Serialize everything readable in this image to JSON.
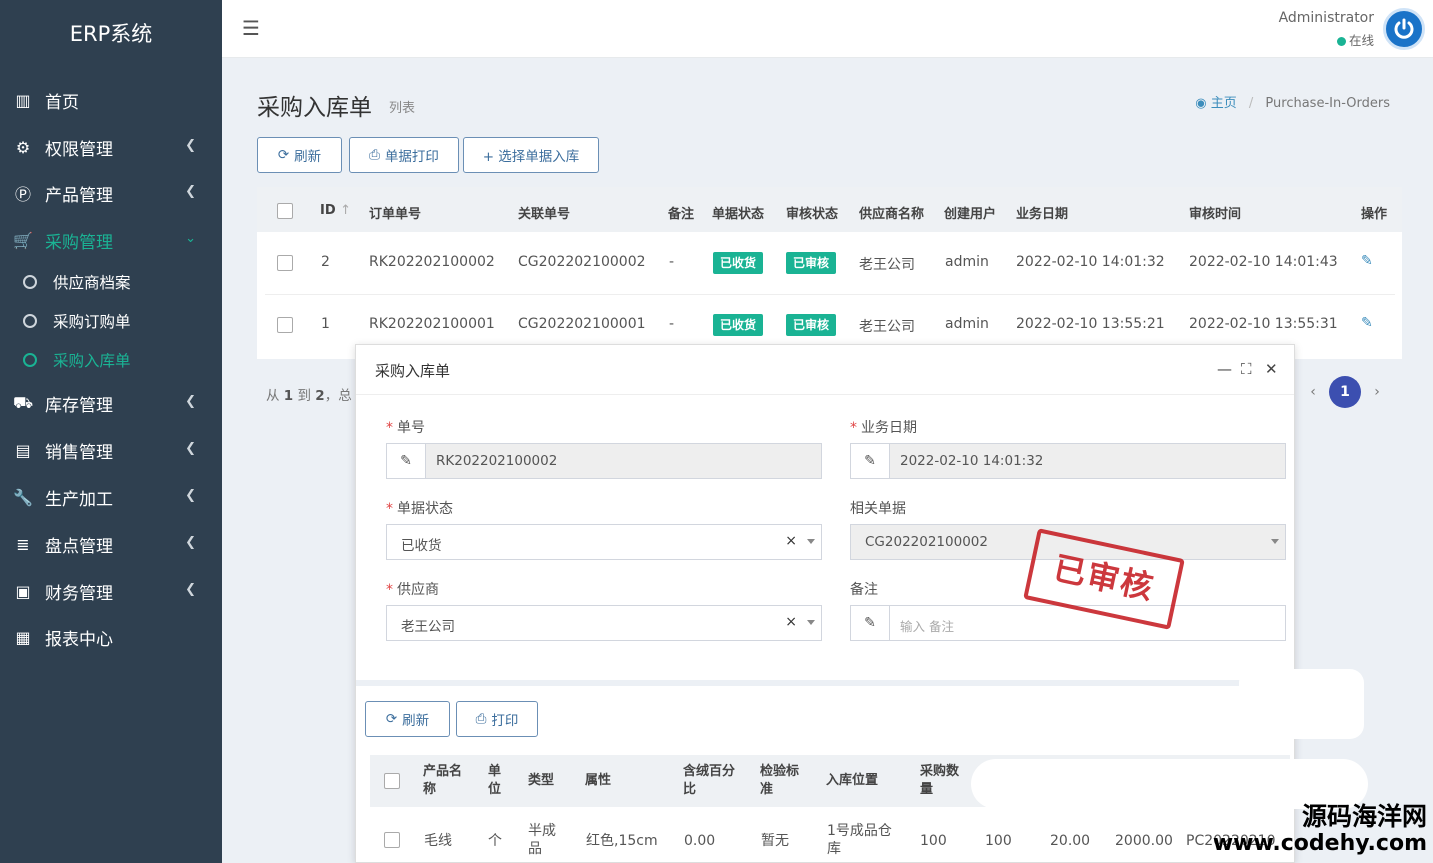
{
  "app": {
    "brand": "ERP系统"
  },
  "sidebar": {
    "items": [
      {
        "label": "首页",
        "icon": "bar-chart-icon"
      },
      {
        "label": "权限管理",
        "icon": "gear-icon"
      },
      {
        "label": "产品管理",
        "icon": "product-p-icon"
      },
      {
        "label": "采购管理",
        "icon": "cart-icon"
      },
      {
        "label": "库存管理",
        "icon": "truck-icon"
      },
      {
        "label": "销售管理",
        "icon": "calendar-icon"
      },
      {
        "label": "生产加工",
        "icon": "wrench-icon"
      },
      {
        "label": "盘点管理",
        "icon": "database-icon"
      },
      {
        "label": "财务管理",
        "icon": "money-icon"
      },
      {
        "label": "报表中心",
        "icon": "calendar-grid-icon"
      }
    ],
    "submenu": [
      "供应商档案",
      "采购订购单",
      "采购入库单"
    ]
  },
  "header": {
    "user_name": "Administrator",
    "user_status": "在线"
  },
  "page": {
    "title": "采购入库单",
    "subtitle": "列表",
    "breadcrumb_home": "主页",
    "breadcrumb_sep": "/",
    "breadcrumb_current": "Purchase-In-Orders"
  },
  "toolbar": {
    "refresh": "刷新",
    "print": "单据打印",
    "select": "+ 选择单据入库"
  },
  "table": {
    "columns": [
      "ID",
      "订单单号",
      "关联单号",
      "备注",
      "单据状态",
      "审核状态",
      "供应商名称",
      "创建用户",
      "业务日期",
      "审核时间",
      "操作"
    ],
    "rows": [
      {
        "id": "2",
        "order_no": "RK202202100002",
        "related_no": "CG202202100002",
        "remark": "-",
        "doc_status": "已收货",
        "audit_status": "已审核",
        "supplier": "老王公司",
        "user": "admin",
        "date": "2022-02-10 14:01:32",
        "audit_time": "2022-02-10 14:01:43"
      },
      {
        "id": "1",
        "order_no": "RK202202100001",
        "related_no": "CG202202100001",
        "remark": "-",
        "doc_status": "已收货",
        "audit_status": "已审核",
        "supplier": "老王公司",
        "user": "admin",
        "date": "2022-02-10 13:55:21",
        "audit_time": "2022-02-10 13:55:31"
      }
    ]
  },
  "pagination": {
    "prefix": "从",
    "from": "1",
    "mid": "到",
    "to": "2",
    "suffix": "，总",
    "current": "1",
    "prev": "‹",
    "next": "›"
  },
  "modal": {
    "title": "采购入库单",
    "fields": {
      "order_no_label": "单号",
      "order_no_value": "RK202202100002",
      "date_label": "业务日期",
      "date_value": "2022-02-10 14:01:32",
      "status_label": "单据状态",
      "status_value": "已收货",
      "related_label": "相关单据",
      "related_value": "CG202202100002",
      "supplier_label": "供应商",
      "supplier_value": "老王公司",
      "remark_label": "备注",
      "remark_placeholder": "输入 备注"
    },
    "stamp": "已审核",
    "detail_toolbar": {
      "refresh": "刷新",
      "print": "打印"
    },
    "detail_columns": [
      "产品名称",
      "单位",
      "类型",
      "属性",
      "含绒百分比",
      "检验标准",
      "入库位置",
      "采购数量"
    ],
    "detail_row": {
      "name": "毛线",
      "unit": "个",
      "type": "半成品",
      "attr": "红色,15cm",
      "pct": "0.00",
      "standard": "暂无",
      "location": "1号成品仓库",
      "qty": "100",
      "qty2": "100",
      "price": "20.00",
      "amount": "2000.00",
      "code": "PC20220210"
    }
  },
  "watermark": {
    "line1": "源码海洋网",
    "line2": "www.codehy.com"
  },
  "colors": {
    "sidebar_bg": "#2f4050",
    "accent": "#1ab394",
    "primary_border": "#6b8fb5",
    "stamp": "#c4161c"
  }
}
